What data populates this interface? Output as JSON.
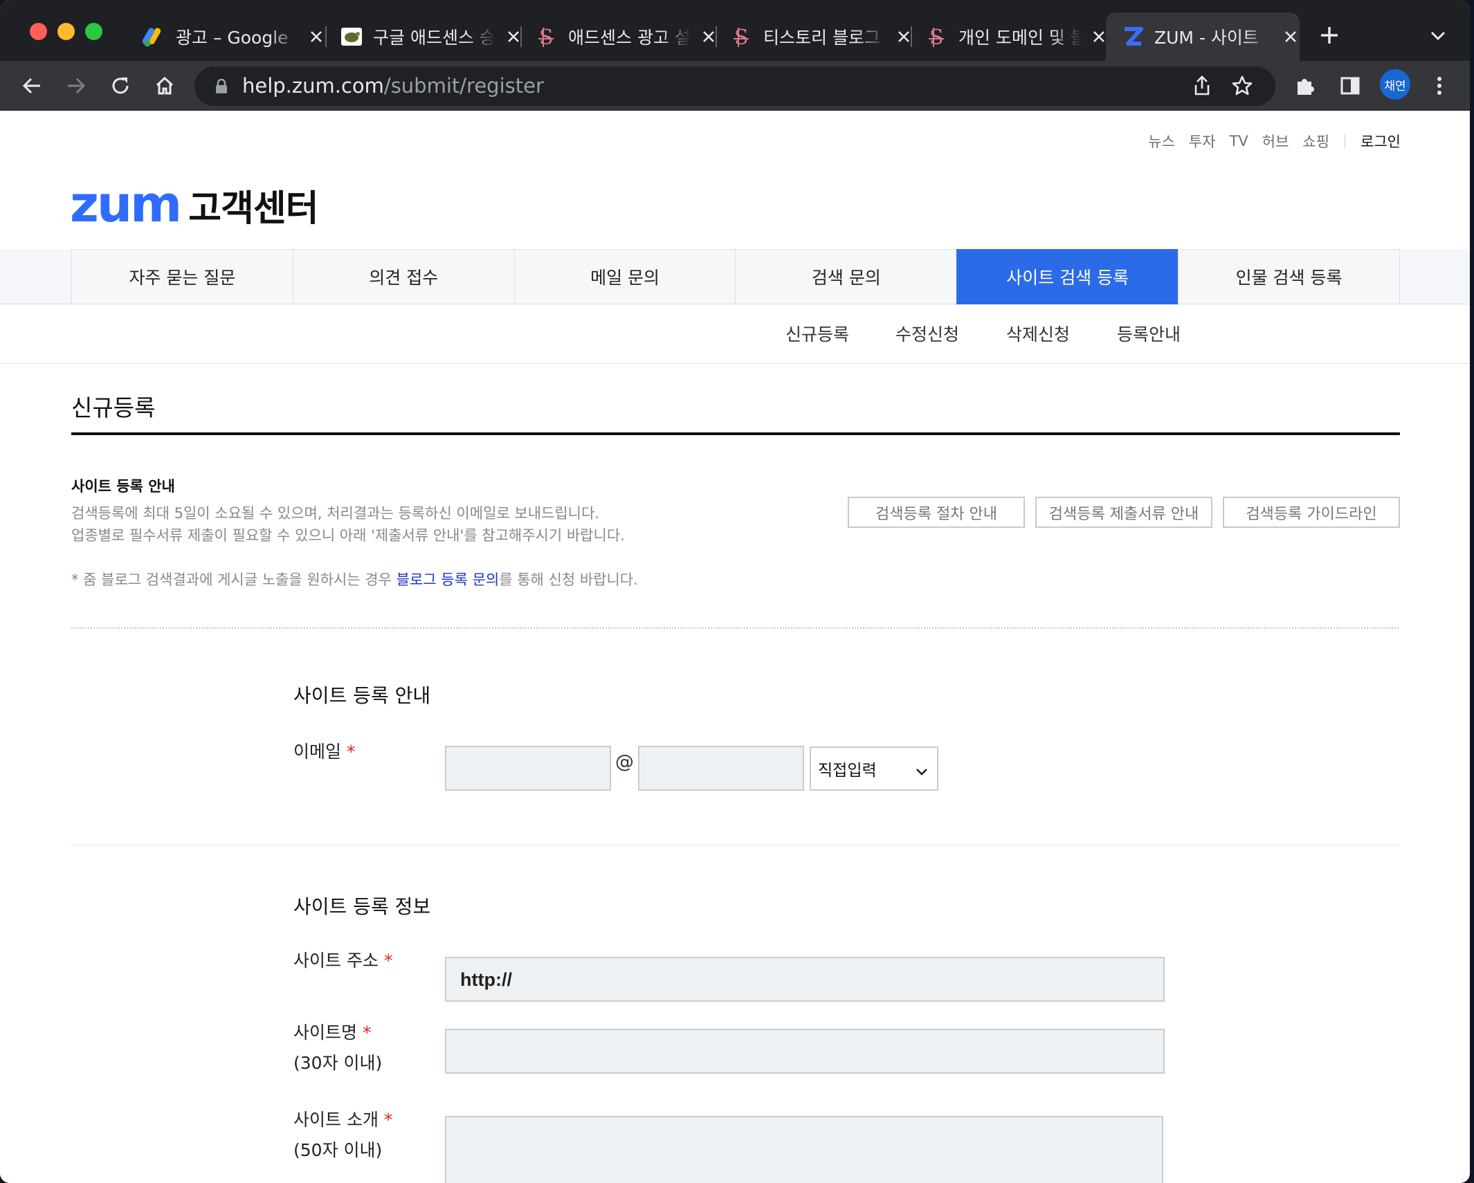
{
  "browser": {
    "tabs": [
      {
        "title": "광고 – Google",
        "icon": "google-ads-icon",
        "active": false
      },
      {
        "title": "구글 애드센스 승",
        "icon": "turtle-favicon-icon",
        "active": false
      },
      {
        "title": "애드센스 광고 설",
        "icon": "tistory-s-icon",
        "active": false
      },
      {
        "title": "티스토리 블로그",
        "icon": "tistory-s-icon",
        "active": false
      },
      {
        "title": "개인 도메인 및 블",
        "icon": "tistory-s-icon",
        "active": false
      },
      {
        "title": "ZUM - 사이트",
        "icon": "zum-z-icon",
        "active": true
      }
    ],
    "url_host": "help.zum.com",
    "url_path": "/submit/register",
    "profile_label": "채연"
  },
  "util_links": [
    "뉴스",
    "투자",
    "TV",
    "허브",
    "쇼핑"
  ],
  "login_label": "로그인",
  "logo": {
    "brand": "zum",
    "suffix": "고객센터"
  },
  "gnb": [
    "자주 묻는 질문",
    "의견 접수",
    "메일 문의",
    "검색 문의",
    "사이트 검색 등록",
    "인물 검색 등록"
  ],
  "gnb_active": "사이트 검색 등록",
  "lnb": [
    "신규등록",
    "수정신청",
    "삭제신청",
    "등록안내"
  ],
  "page_title": "신규등록",
  "guide": {
    "heading": "사이트 등록 안내",
    "line1": "검색등록에 최대 5일이 소요될 수 있으며, 처리결과는 등록하신 이메일로 보내드립니다.",
    "line2": "업종별로 필수서류 제출이 필요할 수 있으니 아래 '제출서류 안내'를 참고해주시기 바랍니다.",
    "note_prefix": "* 줌 블로그 검색결과에 게시글 노출을 원하시는 경우 ",
    "note_link": "블로그 등록 문의",
    "note_suffix": "를 통해 신청 바랍니다.",
    "buttons": [
      "검색등록 절차 안내",
      "검색등록 제출서류 안내",
      "검색등록 가이드라인"
    ]
  },
  "section1": {
    "title": "사이트 등록 안내",
    "email_label": "이메일",
    "at_sign": "@",
    "domain_select": "직접입력"
  },
  "section2": {
    "title": "사이트 등록 정보",
    "site_url_label": "사이트 주소",
    "site_url_value": "http://",
    "site_name_label": "사이트명",
    "site_name_limit": "(30자 이내)",
    "site_intro_label": "사이트 소개",
    "site_intro_limit": "(50자 이내)"
  },
  "required_mark": "*",
  "colors": {
    "brand": "#2f6bff",
    "active_tab": "#2c6be8",
    "required": "#e22222",
    "link": "#1a35c9"
  }
}
